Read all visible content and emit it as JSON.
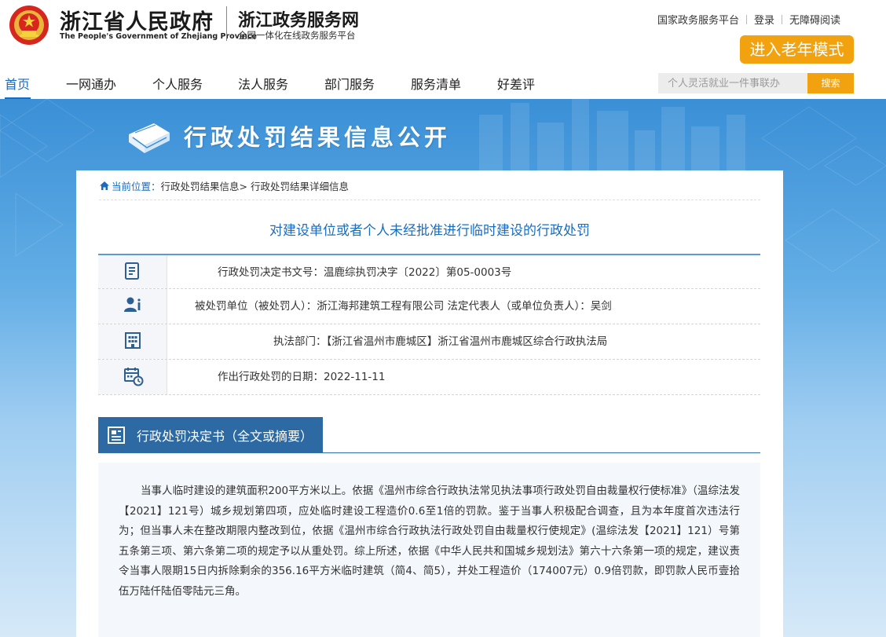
{
  "header": {
    "gov_title": "浙江省人民政府",
    "gov_subtitle": "The People's Government of Zhejiang Province",
    "service_title": "浙江政务服务网",
    "service_subtitle": "全国一体化在线政务服务平台",
    "top_links": [
      "国家政务服务平台",
      "登录",
      "无障碍阅读"
    ],
    "elder_mode_label": "进入老年模式",
    "accent_color": "#f2a20f"
  },
  "nav": {
    "items": [
      "首页",
      "一网通办",
      "个人服务",
      "法人服务",
      "部门服务",
      "服务清单",
      "好差评"
    ],
    "active_index": 0,
    "search_placeholder": "个人灵活就业一件事联办",
    "search_button": "搜索"
  },
  "banner": {
    "title": "行政处罚结果信息公开"
  },
  "breadcrumb": {
    "current_label": "当前位置：",
    "path": "行政处罚结果信息> 行政处罚结果详细信息"
  },
  "page_title": "对建设单位或者个人未经批准进行临时建设的行政处罚",
  "info": {
    "decision_no": "行政处罚决定书文号：温鹿综执罚决字〔2022〕第05-0003号",
    "punished_party": "被处罚单位（被处罚人）：浙江海邦建筑工程有限公司    法定代表人（或单位负责人）：吴剑",
    "department": "执法部门：【浙江省温州市鹿城区】浙江省温州市鹿城区综合行政执法局",
    "date": "作出行政处罚的日期：2022-11-11"
  },
  "document": {
    "tab_label": "行政处罚决定书（全文或摘要）",
    "body": "当事人临时建设的建筑面积200平方米以上。依据《温州市综合行政执法常见执法事项行政处罚自由裁量权行使标准》（温综法发【2021】121号）城乡规划第四项，应处临时建设工程造价0.6至1倍的罚款。鉴于当事人积极配合调查，且为本年度首次违法行为；但当事人未在整改期限内整改到位，依据《温州市综合行政执法行政处罚自由裁量权行使规定》(温综法发【2021】121）号第五条第三项、第六条第二项的规定予以从重处罚。综上所述，依据《中华人民共和国城乡规划法》第六十六条第一项的规定，建议责令当事人限期15日内拆除剩余的356.16平方米临时建筑（简4、简5），并处工程造价（174007元）0.9倍罚款，即罚款人民币壹拾伍万陆仟陆佰零陆元三角。"
  }
}
